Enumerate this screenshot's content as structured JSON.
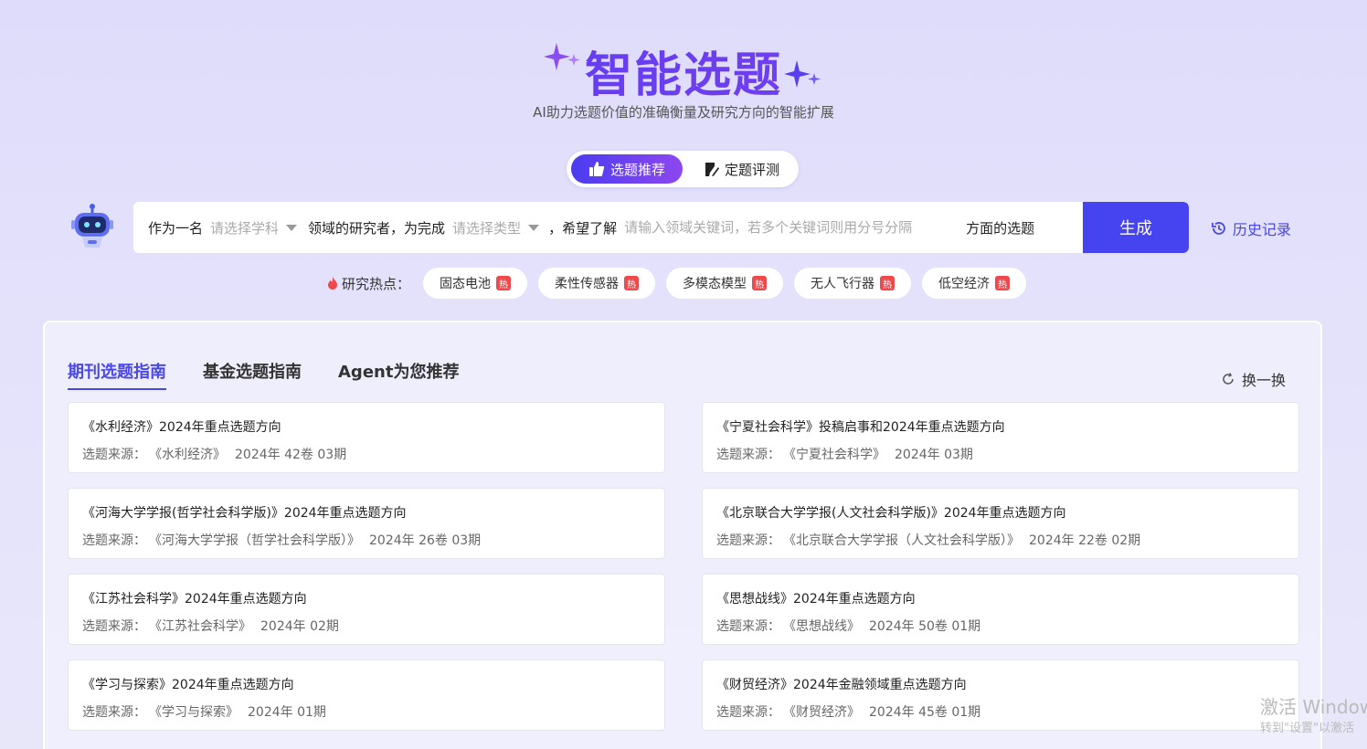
{
  "header": {
    "title": "智能选题",
    "subtitle": "AI助力选题价值的准确衡量及研究方向的智能扩展"
  },
  "mode_switch": {
    "active_label": "选题推荐",
    "other_label": "定题评测"
  },
  "query": {
    "prefix": "作为一名",
    "subject_placeholder": "请选择学科",
    "middle": "领域的研究者，为完成",
    "type_placeholder": "请选择类型",
    "hope_text": "，希望了解",
    "keyword_placeholder": "请输入领域关键词，若多个关键词则用分号分隔",
    "suffix": "方面的选题",
    "generate_label": "生成",
    "history_label": "历史记录"
  },
  "hot": {
    "label": "研究热点：",
    "tag": "热",
    "items": [
      "固态电池",
      "柔性传感器",
      "多模态模型",
      "无人飞行器",
      "低空经济"
    ]
  },
  "panel": {
    "tabs": [
      "期刊选题指南",
      "基金选题指南",
      "Agent为您推荐"
    ],
    "refresh_label": "换一换",
    "source_label": "选题来源：",
    "cards": [
      {
        "title": "《水利经济》2024年重点选题方向",
        "source": "《水利经济》",
        "issue": "2024年 42卷 03期"
      },
      {
        "title": "《宁夏社会科学》投稿启事和2024年重点选题方向",
        "source": "《宁夏社会科学》",
        "issue": "2024年 03期"
      },
      {
        "title": "《河海大学学报(哲学社会科学版)》2024年重点选题方向",
        "source": "《河海大学学报（哲学社会科学版）》",
        "issue": "2024年 26卷 03期"
      },
      {
        "title": "《北京联合大学学报(人文社会科学版)》2024年重点选题方向",
        "source": "《北京联合大学学报（人文社会科学版）》",
        "issue": "2024年 22卷 02期"
      },
      {
        "title": "《江苏社会科学》2024年重点选题方向",
        "source": "《江苏社会科学》",
        "issue": "2024年 02期"
      },
      {
        "title": "《思想战线》2024年重点选题方向",
        "source": "《思想战线》",
        "issue": "2024年 50卷 01期"
      },
      {
        "title": "《学习与探索》2024年重点选题方向",
        "source": "《学习与探索》",
        "issue": "2024年 01期"
      },
      {
        "title": "《财贸经济》2024年金融领域重点选题方向",
        "source": "《财贸经济》",
        "issue": "2024年 45卷 01期"
      }
    ]
  },
  "watermark": {
    "line1": "激活 Window",
    "line2": "转到\"设置\"以激活"
  },
  "colors": {
    "accent": "#4643f0",
    "hot_tag": "#f0484b"
  }
}
